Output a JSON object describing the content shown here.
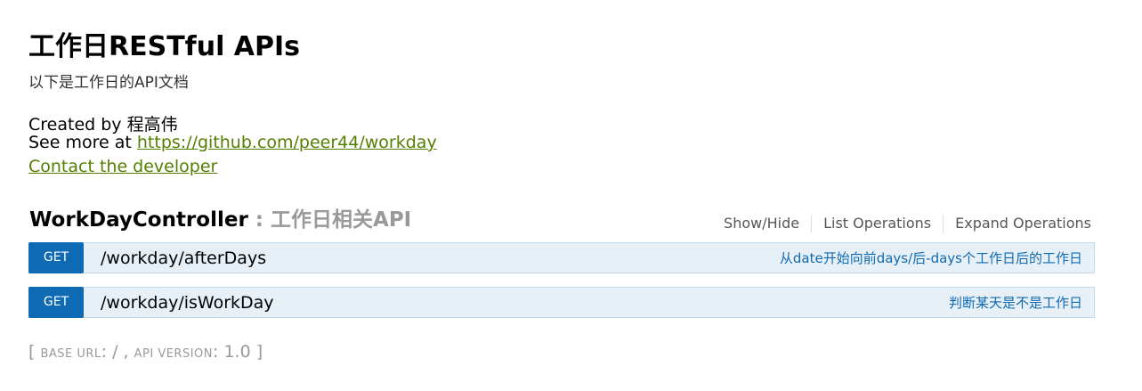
{
  "header": {
    "title": "工作日RESTful APIs",
    "description": "以下是工作日的API文档"
  },
  "info": {
    "created_by_prefix": "Created by ",
    "created_by_name": "程高伟",
    "see_more_prefix": "See more at ",
    "see_more_url": "https://github.com/peer44/workday",
    "contact_label": "Contact the developer"
  },
  "resource": {
    "name": "WorkDayController",
    "separator": " : ",
    "description": "工作日相关API",
    "options": {
      "show_hide": "Show/Hide",
      "list_operations": "List Operations",
      "expand_operations": "Expand Operations"
    }
  },
  "operations": [
    {
      "method": "GET",
      "path": "/workday/afterDays",
      "summary": "从date开始向前days/后-days个工作日后的工作日"
    },
    {
      "method": "GET",
      "path": "/workday/isWorkDay",
      "summary": "判断某天是不是工作日"
    }
  ],
  "footer": {
    "open_bracket": "[ ",
    "base_url_label": "BASE URL",
    "base_url_value": ": / , ",
    "api_version_label": "API VERSION",
    "api_version_value": ": 1.0 ",
    "close_bracket": "]"
  },
  "colors": {
    "link": "#547f00",
    "get_method": "#0f6ab4",
    "get_row_bg": "#e7f0f7",
    "get_row_border": "#c3d9ec",
    "muted": "#999999"
  }
}
